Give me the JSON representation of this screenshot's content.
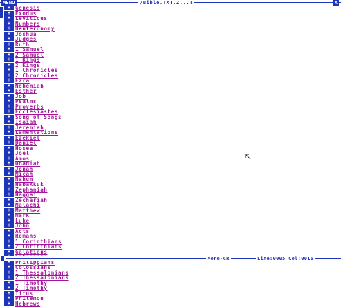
{
  "titlebar": {
    "menu_label": "MENU",
    "file_title": "/Bible.TXT.Z...T",
    "close_label": "X"
  },
  "toggle_symbol": "+",
  "books": [
    "Genesis",
    "Exodus",
    "Leviticus",
    "Numbers",
    "Deuteronomy",
    "Joshua",
    "Judges",
    "Ruth",
    "1 Samuel",
    "2 Samuel",
    "1 Kings",
    "2 Kings",
    "1 Chronicles",
    "2 Chronicles",
    "Ezra",
    "Nehemiah",
    "Esther",
    "Job",
    "Psalms",
    "Proverbs",
    "Ecclesiastes",
    "Song of Songs",
    "Isaiah",
    "Jeremiah",
    "Lamentations",
    "Ezekiel",
    "Daniel",
    "Hosea",
    "Joel",
    "Amos",
    "Obadiah",
    "Jonah",
    "Micah",
    "Nahum",
    "Habakkuk",
    "Zephaniah",
    "Haggai",
    "Zechariah",
    "Malachi",
    "Matthew",
    "Mark",
    "Luke",
    "John",
    "Acts",
    "Romans",
    "1 Corinthians",
    "2 Corinthians",
    "Galatians",
    "Ephesians",
    "Philippians",
    "Colossians",
    "1 Thessalonians",
    "2 Thessalonians",
    "1 Timothy",
    "2 Timothy",
    "Titus",
    "Philemon",
    "Hebrews"
  ],
  "statusbar": {
    "more_label": "More-CR",
    "position": "Line:0005 Col:0015"
  },
  "colors": {
    "accent_blue": "#1d35b8",
    "link_magenta": "#a3169a",
    "background": "#ffffff"
  },
  "icons": {
    "pointer": "mouse-pointer-icon"
  }
}
